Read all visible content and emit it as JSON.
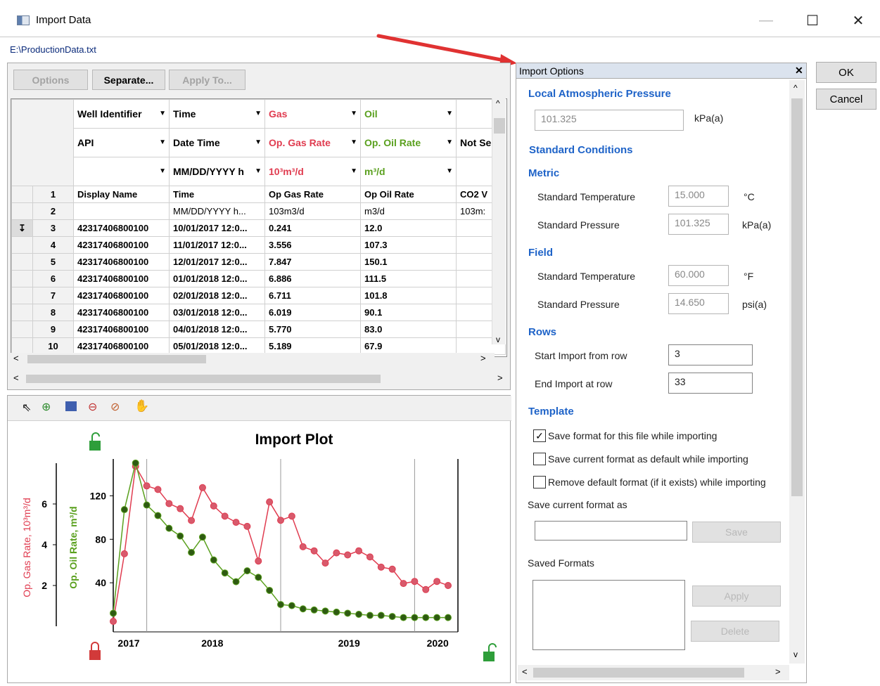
{
  "window": {
    "title": "Import Data",
    "file_path": "E:\\ProductionData.txt"
  },
  "toolbar": {
    "options": "Options",
    "separate": "Separate...",
    "apply_to": "Apply To..."
  },
  "grid": {
    "col_headers": [
      {
        "type": "Well Identifier",
        "subtype": "API",
        "unit": ""
      },
      {
        "type": "Time",
        "subtype": "Date Time",
        "unit": "MM/DD/YYYY h"
      },
      {
        "type": "Gas",
        "subtype": "Op. Gas Rate",
        "unit": "10³m³/d"
      },
      {
        "type": "Oil",
        "subtype": "Op. Oil Rate",
        "unit": "m³/d"
      },
      {
        "type": "",
        "subtype": "Not Se",
        "unit": ""
      }
    ],
    "rows": [
      {
        "n": "1",
        "c": [
          "Display Name",
          "Time",
          "Op Gas Rate",
          "Op Oil Rate",
          "CO2 V"
        ]
      },
      {
        "n": "2",
        "c": [
          "",
          "MM/DD/YYYY h...",
          "103m3/d",
          "m3/d",
          "103m:"
        ]
      },
      {
        "n": "3",
        "c": [
          "42317406800100",
          "10/01/2017 12:0...",
          "0.241",
          "12.0",
          ""
        ]
      },
      {
        "n": "4",
        "c": [
          "42317406800100",
          "11/01/2017 12:0...",
          "3.556",
          "107.3",
          ""
        ]
      },
      {
        "n": "5",
        "c": [
          "42317406800100",
          "12/01/2017 12:0...",
          "7.847",
          "150.1",
          ""
        ]
      },
      {
        "n": "6",
        "c": [
          "42317406800100",
          "01/01/2018 12:0...",
          "6.886",
          "111.5",
          ""
        ]
      },
      {
        "n": "7",
        "c": [
          "42317406800100",
          "02/01/2018 12:0...",
          "6.711",
          "101.8",
          ""
        ]
      },
      {
        "n": "8",
        "c": [
          "42317406800100",
          "03/01/2018 12:0...",
          "6.019",
          "90.1",
          ""
        ]
      },
      {
        "n": "9",
        "c": [
          "42317406800100",
          "04/01/2018 12:0...",
          "5.770",
          "83.0",
          ""
        ]
      },
      {
        "n": "10",
        "c": [
          "42317406800100",
          "05/01/2018 12:0...",
          "5.189",
          "67.9",
          ""
        ]
      }
    ]
  },
  "plot": {
    "title": "Import Plot",
    "gas_axis_label": "Op. Gas Rate, 10³m³/d",
    "oil_axis_label": "Op. Oil Rate, m³/d",
    "gas_ticks": [
      "2",
      "4",
      "6"
    ],
    "oil_ticks": [
      "40",
      "80",
      "120"
    ],
    "year_labels": [
      "2017",
      "2018",
      "2019",
      "2020"
    ],
    "gas_color": "#e03c50",
    "oil_color": "#5aa01e"
  },
  "chart_data": {
    "type": "line",
    "title": "Import Plot",
    "x": [
      "2017-10",
      "2017-11",
      "2017-12",
      "2018-01",
      "2018-02",
      "2018-03",
      "2018-04",
      "2018-05",
      "2018-06",
      "2018-07",
      "2018-08",
      "2018-09",
      "2018-10",
      "2018-11",
      "2018-12",
      "2019-01",
      "2019-02",
      "2019-03",
      "2019-04",
      "2019-05",
      "2019-06",
      "2019-07",
      "2019-08",
      "2019-09",
      "2019-10",
      "2019-11",
      "2019-12",
      "2020-01",
      "2020-02",
      "2020-03",
      "2020-04"
    ],
    "series": [
      {
        "name": "Op. Gas Rate",
        "axis": "left",
        "values": [
          0.241,
          3.556,
          7.847,
          6.886,
          6.711,
          6.019,
          5.77,
          5.189,
          6.8,
          5.9,
          5.4,
          5.1,
          4.9,
          3.2,
          6.1,
          5.2,
          5.4,
          3.9,
          3.7,
          3.1,
          3.6,
          3.5,
          3.7,
          3.4,
          2.9,
          2.8,
          2.1,
          2.2,
          1.8,
          2.2,
          2.0
        ]
      },
      {
        "name": "Op. Oil Rate",
        "axis": "right",
        "values": [
          12.0,
          107.3,
          150.1,
          111.5,
          101.8,
          90.1,
          83.0,
          67.9,
          82,
          61,
          49,
          41,
          51,
          45,
          33,
          20,
          19,
          16,
          15,
          14,
          13,
          12,
          11,
          10,
          10,
          9,
          8,
          8,
          8,
          8,
          8
        ]
      }
    ],
    "xlabel": "",
    "ylabel_left": "Op. Gas Rate, 10³m³/d",
    "ylabel_right": "Op. Oil Rate, m³/d",
    "ylim_left": [
      0,
      8
    ],
    "ylim_right": [
      0,
      150
    ]
  },
  "import_options": {
    "title": "Import Options",
    "local_atm_title": "Local Atmospheric Pressure",
    "local_atm_value": "101.325",
    "local_atm_unit": "kPa(a)",
    "std_conditions_title": "Standard Conditions",
    "metric_title": "Metric",
    "metric_temp_label": "Standard Temperature",
    "metric_temp_value": "15.000",
    "metric_temp_unit": "°C",
    "metric_pres_label": "Standard Pressure",
    "metric_pres_value": "101.325",
    "metric_pres_unit": "kPa(a)",
    "field_title": "Field",
    "field_temp_label": "Standard Temperature",
    "field_temp_value": "60.000",
    "field_temp_unit": "°F",
    "field_pres_label": "Standard Pressure",
    "field_pres_value": "14.650",
    "field_pres_unit": "psi(a)",
    "rows_title": "Rows",
    "start_label": "Start Import from row",
    "start_value": "3",
    "end_label": "End Import at row",
    "end_value": "33",
    "template_title": "Template",
    "chk1_label": "Save format for this file while importing",
    "chk2_label": "Save current format as default while importing",
    "chk3_label": "Remove default format (if it exists) while importing",
    "save_as_label": "Save current format as",
    "save_button": "Save",
    "saved_formats_label": "Saved Formats",
    "apply_button": "Apply",
    "delete_button": "Delete"
  },
  "dialog": {
    "ok": "OK",
    "cancel": "Cancel"
  }
}
